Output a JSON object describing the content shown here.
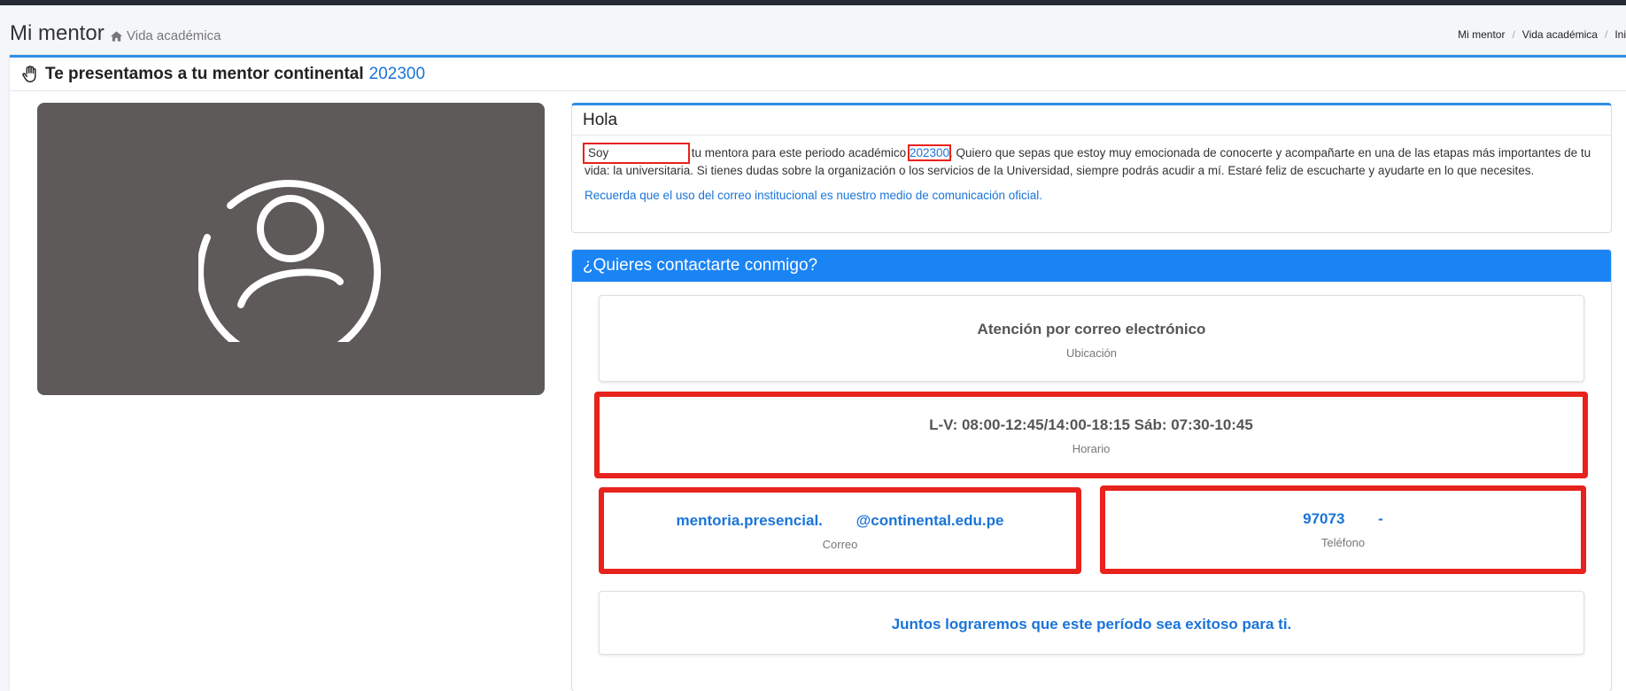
{
  "header": {
    "title": "Mi mentor",
    "subtitle": "Vida académica",
    "breadcrumb": [
      "Mi mentor",
      "Vida académica",
      "Ini"
    ]
  },
  "main": {
    "heading_prefix": "Te presentamos a tu mentor continental",
    "heading_code": "202300"
  },
  "hola": {
    "title": "Hola",
    "soy": "Soy",
    "text_a": "tu mentora para este periodo académico",
    "period": "202300",
    "text_b": ". Quiero que sepas que estoy muy emocionada de conocerte y acompañarte en una de las etapas más importantes de tu vida: la universitaria. Si tienes dudas sobre la organización o los servicios de la Universidad, siempre podrás acudir a mí. Estaré feliz de escucharte y ayudarte en lo que necesites.",
    "note": "Recuerda que el uso del correo institucional es nuestro medio de comunicación oficial."
  },
  "contact": {
    "title": "¿Quieres contactarte conmigo?",
    "attention_value": "Atención por correo electrónico",
    "attention_label": "Ubicación",
    "schedule_value": "L-V: 08:00-12:45/14:00-18:15 Sáb: 07:30-10:45",
    "schedule_label": "Horario",
    "email_value": "mentoria.presencial.        @continental.edu.pe",
    "email_label": "Correo",
    "phone_value": "97073        -",
    "phone_label": "Teléfono",
    "closing": "Juntos lograremos que este período sea exitoso para ti."
  },
  "colors": {
    "accent": "#1a84f5",
    "link": "#1a74d8",
    "highlight": "#e8221c",
    "avatar_bg": "#5f5a5a"
  }
}
